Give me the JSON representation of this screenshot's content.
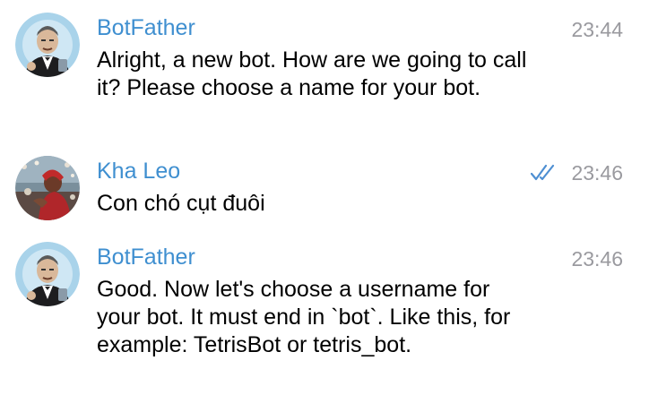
{
  "messages": [
    {
      "avatar": "botfather-avatar",
      "sender": "BotFather",
      "time": "23:44",
      "text": "Alright, a new bot. How are we going to call it? Please choose a name for your bot."
    },
    {
      "avatar": "user-photo-avatar",
      "sender": "Kha Leo",
      "time": "23:46",
      "status": "read-double-check",
      "text": "Con chó cụt đuôi"
    },
    {
      "avatar": "botfather-avatar",
      "sender": "BotFather",
      "time": "23:46",
      "text": "Good. Now let's choose a username for your bot. It must end in `bot`. Like this, for example: TetrisBot or tetris_bot."
    }
  ],
  "colors": {
    "sender_name": "#3f8fd0",
    "timestamp": "#9a9a9f",
    "read_check": "#4e8fd2",
    "message_text": "#000000"
  }
}
